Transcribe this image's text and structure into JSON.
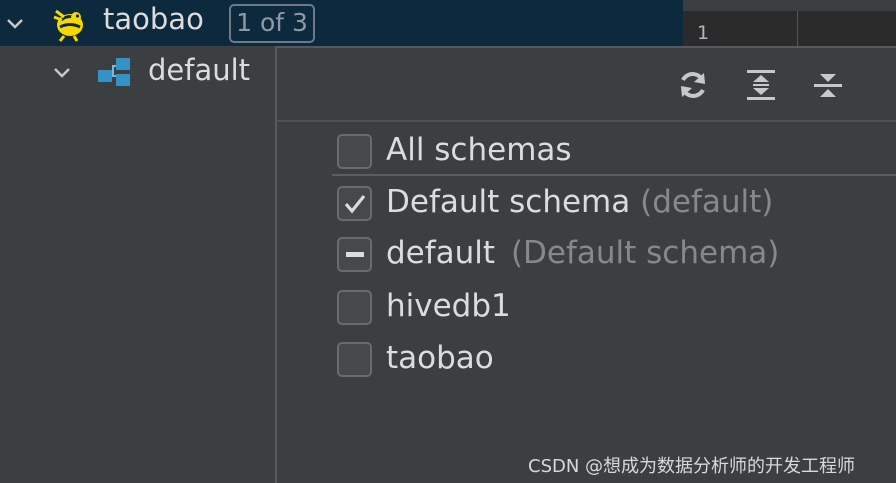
{
  "tree": {
    "root": {
      "label": "taobao",
      "badge": "1 of 3",
      "icon": "hive-bee-icon",
      "expanded": true
    },
    "child": {
      "label": "default",
      "icon": "schema-icon",
      "expanded": true
    }
  },
  "editor": {
    "line_number": "1"
  },
  "popup": {
    "toolbar": [
      {
        "name": "refresh-icon"
      },
      {
        "name": "expand-all-icon"
      },
      {
        "name": "collapse-all-icon"
      }
    ],
    "items": [
      {
        "label": "All schemas",
        "note": "",
        "state": "unchecked"
      },
      {
        "label": "Default schema",
        "note": "(default)",
        "state": "checked"
      },
      {
        "label": "default",
        "note": "(Default schema)",
        "state": "indeterminate"
      },
      {
        "label": "hivedb1",
        "note": "",
        "state": "unchecked"
      },
      {
        "label": "taobao",
        "note": "",
        "state": "unchecked"
      }
    ]
  },
  "watermark": "CSDN @想成为数据分析师的开发工程师",
  "colors": {
    "selection": "#0d293e",
    "panel": "#3c3f41",
    "hive_yellow": "#f5d800",
    "schema_blue": "#3592c4"
  }
}
